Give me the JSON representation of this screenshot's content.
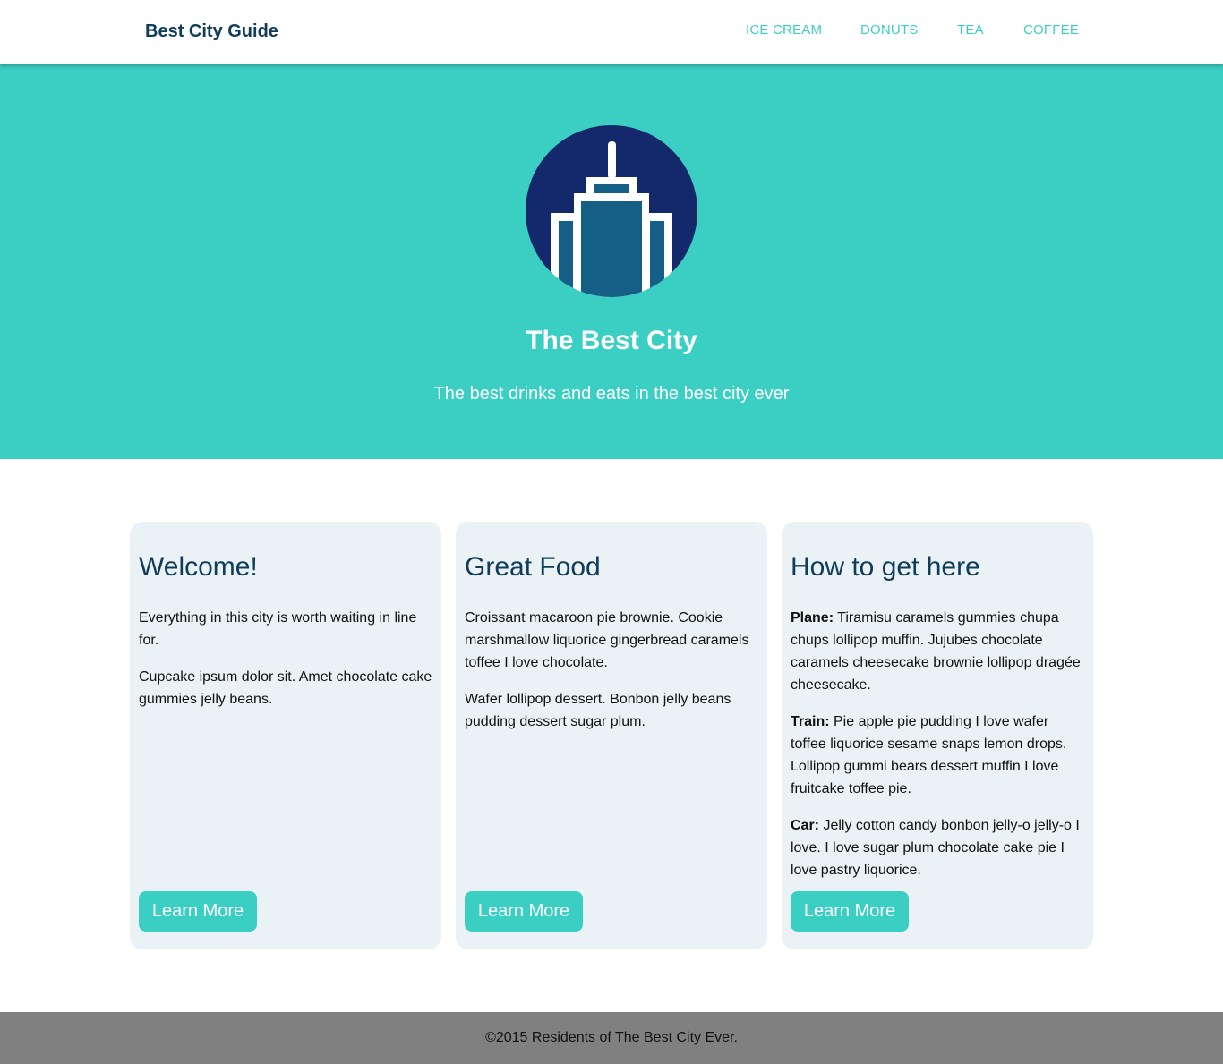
{
  "colors": {
    "accent": "#3bcfc4",
    "navy": "#0f3c5a",
    "logo_circle": "#13296b",
    "logo_building": "#155e85",
    "card_bg": "#eaf2f5",
    "footer_bg": "#808080"
  },
  "navbar": {
    "brand": "Best City Guide",
    "links": [
      {
        "label": "ICE CREAM"
      },
      {
        "label": "DONUTS"
      },
      {
        "label": "TEA"
      },
      {
        "label": "COFFEE"
      }
    ]
  },
  "hero": {
    "logo_icon": "city-building-icon",
    "title": "The Best City",
    "subtitle": "The best drinks and eats in the best city ever"
  },
  "cards": [
    {
      "title": "Welcome!",
      "paragraphs": [
        {
          "label": "",
          "text": "Everything in this city is worth waiting in line for."
        },
        {
          "label": "",
          "text": "Cupcake ipsum dolor sit. Amet chocolate cake gummies jelly beans."
        }
      ],
      "button": "Learn More"
    },
    {
      "title": "Great Food",
      "paragraphs": [
        {
          "label": "",
          "text": "Croissant macaroon pie brownie. Cookie marshmallow liquorice gingerbread caramels toffee I love chocolate."
        },
        {
          "label": "",
          "text": "Wafer lollipop dessert. Bonbon jelly beans pudding dessert sugar plum."
        }
      ],
      "button": "Learn More"
    },
    {
      "title": "How to get here",
      "paragraphs": [
        {
          "label": "Plane:",
          "text": " Tiramisu caramels gummies chupa chups lollipop muffin. Jujubes chocolate caramels cheesecake brownie lollipop dragée cheesecake."
        },
        {
          "label": "Train:",
          "text": " Pie apple pie pudding I love wafer toffee liquorice sesame snaps lemon drops. Lollipop gummi bears dessert muffin I love fruitcake toffee pie."
        },
        {
          "label": "Car:",
          "text": " Jelly cotton candy bonbon jelly-o jelly-o I love. I love sugar plum chocolate cake pie I love pastry liquorice."
        }
      ],
      "button": "Learn More"
    }
  ],
  "footer": {
    "text": "©2015 Residents of The Best City Ever."
  }
}
